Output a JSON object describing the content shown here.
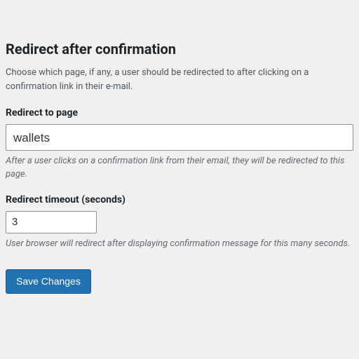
{
  "section": {
    "title": "Redirect after confirmation",
    "description": "Choose which page, if any, a user should be redirected to after clicking on a confirmation link in their e-mail."
  },
  "fields": {
    "redirect_page": {
      "label": "Redirect to page",
      "value": "wallets",
      "help": "After a user clicks on a confirmation link from their email, they will be redirected to this page."
    },
    "redirect_timeout": {
      "label": "Redirect timeout (seconds)",
      "value": "3",
      "help": "User browser will redirect after displaying confirmation message for this many seconds."
    }
  },
  "submit": {
    "label": "Save Changes"
  }
}
